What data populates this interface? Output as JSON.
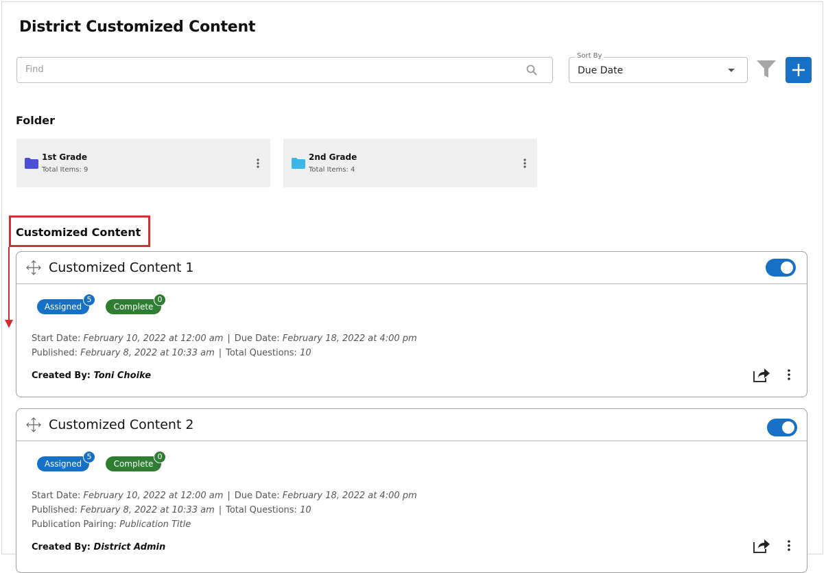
{
  "page": {
    "title": "District Customized Content"
  },
  "search": {
    "placeholder": "Find",
    "value": ""
  },
  "sort": {
    "label": "Sort By",
    "value": "Due Date"
  },
  "folders": {
    "heading": "Folder",
    "items": [
      {
        "name": "1st Grade",
        "count": "Total Items: 9",
        "color": "#4a4fd6"
      },
      {
        "name": "2nd Grade",
        "count": "Total Items: 4",
        "color": "#3db5e6"
      }
    ]
  },
  "content": {
    "heading": "Customized Content",
    "cards": [
      {
        "title": "Customized Content 1",
        "badges": {
          "assigned_label": "Assigned",
          "assigned_count": "5",
          "complete_label": "Complete",
          "complete_count": "0"
        },
        "start_label": "Start Date:",
        "start_value": "February 10, 2022 at 12:00 am",
        "due_label": "Due Date:",
        "due_value": "February 18, 2022 at 4:00 pm",
        "published_label": "Published:",
        "published_value": "February 8, 2022 at 10:33 am",
        "questions_label": "Total Questions:",
        "questions_value": "10",
        "created_label": "Created By:",
        "created_value": "Toni Choike"
      },
      {
        "title": "Customized Content 2",
        "badges": {
          "assigned_label": "Assigned",
          "assigned_count": "5",
          "complete_label": "Complete",
          "complete_count": "0"
        },
        "start_label": "Start Date:",
        "start_value": "February 10, 2022 at 12:00 am",
        "due_label": "Due Date:",
        "due_value": "February 18, 2022 at 4:00 pm",
        "published_label": "Published:",
        "published_value": "February 8, 2022 at 10:33 am",
        "questions_label": "Total Questions:",
        "questions_value": "10",
        "pairing_label": "Publication Pairing:",
        "pairing_value": "Publication Title",
        "created_label": "Created By:",
        "created_value": "District Admin"
      }
    ]
  },
  "colors": {
    "primary": "#1670c5",
    "complete": "#2e7d32",
    "annotation": "#d32f2f"
  }
}
